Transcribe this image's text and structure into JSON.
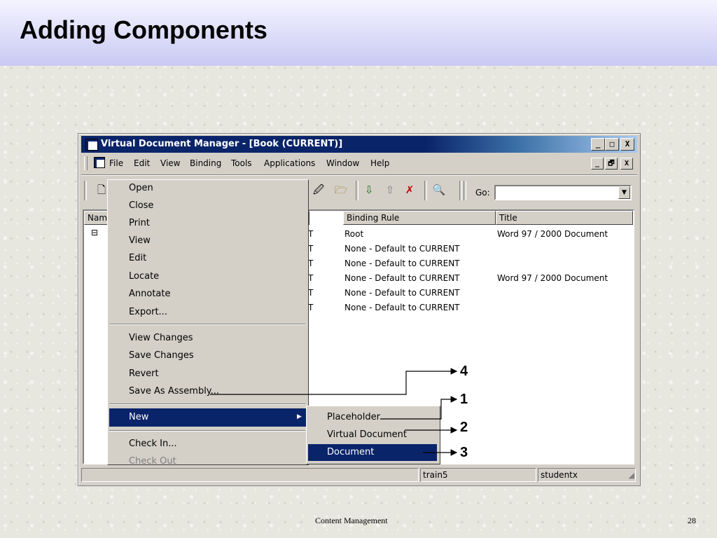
{
  "slide": {
    "title": "Adding Components",
    "footer": "Content Management",
    "page_number": "28"
  },
  "window": {
    "title": "Virtual Document Manager - [Book (CURRENT)]",
    "controls": [
      "_",
      "□",
      "X"
    ],
    "mdi_controls": [
      "_",
      "🗗",
      "X"
    ]
  },
  "menubar": [
    "File",
    "Edit",
    "View",
    "Binding",
    "Tools",
    "Applications",
    "Window",
    "Help"
  ],
  "toolbar": {
    "go_label": "Go:",
    "go_value": ""
  },
  "columns": {
    "name": "Nam",
    "binding_rule": "Binding Rule",
    "title": "Title"
  },
  "tree_expander": "⊟",
  "rows": [
    {
      "state": "T",
      "binding_rule": "Root",
      "title": "Word 97 / 2000 Document"
    },
    {
      "state": "T",
      "binding_rule": "None - Default to CURRENT",
      "title": ""
    },
    {
      "state": "T",
      "binding_rule": "None - Default to CURRENT",
      "title": ""
    },
    {
      "state": "T",
      "binding_rule": "None - Default to CURRENT",
      "title": "Word 97 / 2000 Document"
    },
    {
      "state": "T",
      "binding_rule": "None - Default to CURRENT",
      "title": ""
    },
    {
      "state": "T",
      "binding_rule": "None - Default to CURRENT",
      "title": ""
    }
  ],
  "file_menu": {
    "group1": [
      "Open",
      "Close",
      "Print",
      "View",
      "Edit",
      "Locate",
      "Annotate",
      "Export..."
    ],
    "group2": [
      "View Changes",
      "Save Changes",
      "Revert",
      "Save As Assembly..."
    ],
    "new": "New",
    "group3": [
      "Check In...",
      "Check Out"
    ]
  },
  "new_submenu": [
    "Placeholder",
    "Virtual Document",
    "Document"
  ],
  "statusbar": {
    "docbase": "train5",
    "user": "studentx"
  },
  "callouts": [
    "4",
    "1",
    "2",
    "3"
  ]
}
